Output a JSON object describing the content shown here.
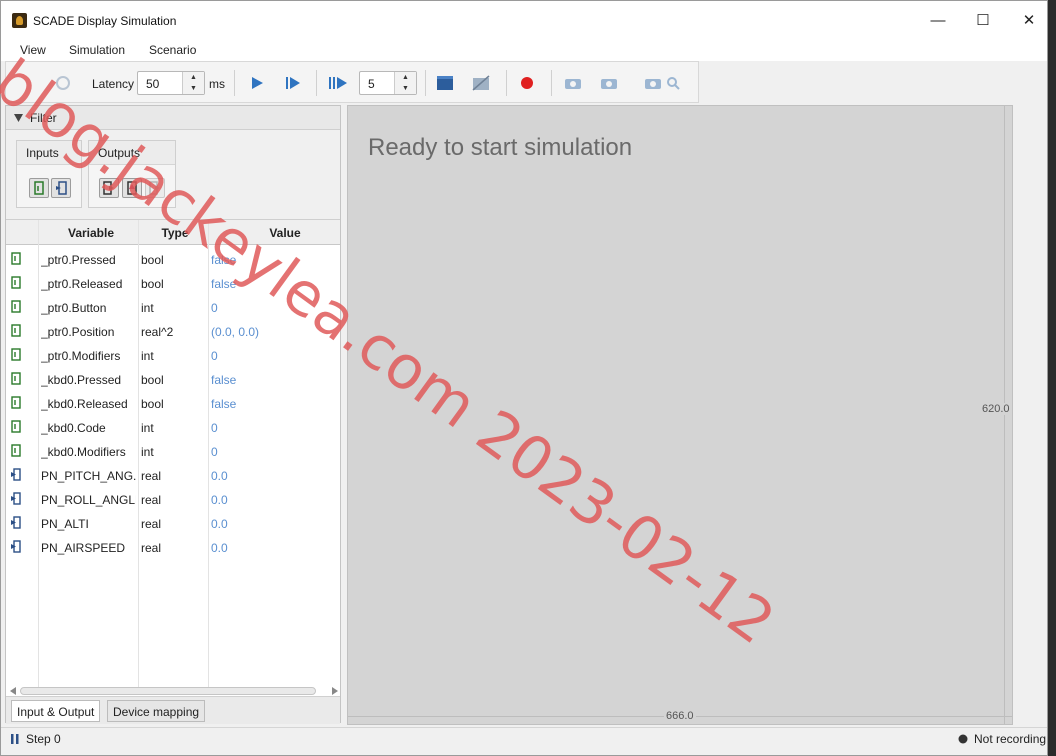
{
  "window": {
    "title": "SCADE Display Simulation",
    "minimize": "—",
    "maximize": "☐",
    "close": "✕"
  },
  "menu": {
    "items": [
      "View",
      "Simulation",
      "Scenario"
    ]
  },
  "toolbar": {
    "latency_label": "Latency",
    "latency_value": "50",
    "latency_unit": "ms",
    "steps_value": "5",
    "icons": [
      "reload-icon",
      "play-icon",
      "step-icon",
      "step-multiple-icon",
      "scenario-icon",
      "disabled-scenario-icon",
      "record-icon",
      "camera-icon",
      "camera-compare-icon",
      "camera-search-icon"
    ]
  },
  "filter": {
    "title": "Filter",
    "inputs_label": "Inputs",
    "outputs_label": "Outputs"
  },
  "table": {
    "headers": {
      "variable": "Variable",
      "type": "Type",
      "value": "Value"
    },
    "rows": [
      {
        "variable": "_ptr0.Pressed",
        "type": "bool",
        "value": "false",
        "kind": "input"
      },
      {
        "variable": "_ptr0.Released",
        "type": "bool",
        "value": "false",
        "kind": "input"
      },
      {
        "variable": "_ptr0.Button",
        "type": "int",
        "value": "0",
        "kind": "input"
      },
      {
        "variable": "_ptr0.Position",
        "type": "real^2",
        "value": "(0.0, 0.0)",
        "kind": "input"
      },
      {
        "variable": "_ptr0.Modifiers",
        "type": "int",
        "value": "0",
        "kind": "input"
      },
      {
        "variable": "_kbd0.Pressed",
        "type": "bool",
        "value": "false",
        "kind": "input"
      },
      {
        "variable": "_kbd0.Released",
        "type": "bool",
        "value": "false",
        "kind": "input"
      },
      {
        "variable": "_kbd0.Code",
        "type": "int",
        "value": "0",
        "kind": "input"
      },
      {
        "variable": "_kbd0.Modifiers",
        "type": "int",
        "value": "0",
        "kind": "input"
      },
      {
        "variable": "PN_PITCH_ANG...",
        "type": "real",
        "value": "0.0",
        "kind": "output"
      },
      {
        "variable": "PN_ROLL_ANGLE",
        "type": "real",
        "value": "0.0",
        "kind": "output"
      },
      {
        "variable": "PN_ALTI",
        "type": "real",
        "value": "0.0",
        "kind": "output"
      },
      {
        "variable": "PN_AIRSPEED",
        "type": "real",
        "value": "0.0",
        "kind": "output"
      }
    ]
  },
  "tabs": [
    "Input & Output",
    "Device mapping"
  ],
  "canvas": {
    "message": "Ready to start simulation",
    "width_label": "666.0",
    "height_label": "620.0"
  },
  "status": {
    "step": "Step 0",
    "recording": "Not recording"
  },
  "watermark": "blog.jackeylea.com 2023-02-12",
  "colors": {
    "value_text": "#5a8fd0",
    "play": "#2f74c0",
    "record": "#e02020",
    "watermark": "#e05a5a"
  }
}
